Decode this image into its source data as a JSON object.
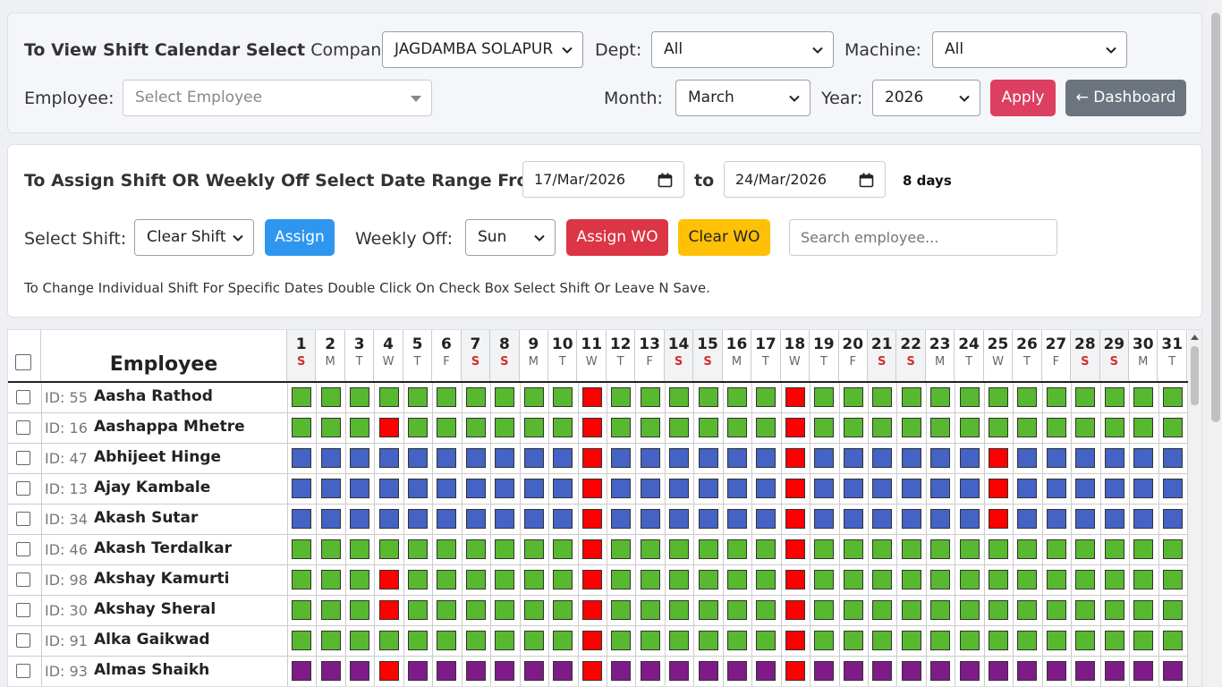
{
  "view": {
    "title": "To View Shift Calendar Select",
    "company_label": "Company:",
    "company_value": "JAGDAMBA SOLAPUR",
    "dept_label": "Dept:",
    "dept_value": "All",
    "machine_label": "Machine:",
    "machine_value": "All",
    "employee_label": "Employee:",
    "employee_placeholder": "Select Employee",
    "month_label": "Month:",
    "month_value": "March",
    "year_label": "Year:",
    "year_value": "2026",
    "apply_label": "Apply",
    "dashboard_label": "← Dashboard"
  },
  "assign": {
    "title": "To Assign Shift OR Weekly Off Select Date Range From:",
    "from_date": "17/Mar/2026",
    "to_label": "to",
    "to_date": "24/Mar/2026",
    "days_count": "8 days",
    "shift_label": "Select Shift:",
    "shift_value": "Clear Shift",
    "assign_label": "Assign",
    "weekly_off_label": "Weekly Off:",
    "weekly_off_value": "Sun",
    "assign_wo_label": "Assign WO",
    "clear_wo_label": "Clear WO",
    "search_placeholder": "Search employee...",
    "note": "To Change Individual Shift For Specific Dates Double Click On Check Box Select Shift Or Leave N Save."
  },
  "colors": {
    "apply": "#dc3f62",
    "dashboard": "#6c757d",
    "assign": "#2e96ef",
    "assign_wo": "#dc3545",
    "clear_wo": "#ffc107",
    "shift_G": "#58b82f",
    "shift_B": "#4463c5",
    "shift_R": "#ff0000",
    "shift_P": "#7f1b88"
  },
  "table": {
    "employee_header": "Employee",
    "days": [
      {
        "n": "1",
        "w": "S",
        "we": true
      },
      {
        "n": "2",
        "w": "M"
      },
      {
        "n": "3",
        "w": "T"
      },
      {
        "n": "4",
        "w": "W"
      },
      {
        "n": "5",
        "w": "T"
      },
      {
        "n": "6",
        "w": "F"
      },
      {
        "n": "7",
        "w": "S",
        "we": true
      },
      {
        "n": "8",
        "w": "S",
        "we": true
      },
      {
        "n": "9",
        "w": "M"
      },
      {
        "n": "10",
        "w": "T"
      },
      {
        "n": "11",
        "w": "W"
      },
      {
        "n": "12",
        "w": "T"
      },
      {
        "n": "13",
        "w": "F"
      },
      {
        "n": "14",
        "w": "S",
        "we": true
      },
      {
        "n": "15",
        "w": "S",
        "we": true
      },
      {
        "n": "16",
        "w": "M"
      },
      {
        "n": "17",
        "w": "T"
      },
      {
        "n": "18",
        "w": "W"
      },
      {
        "n": "19",
        "w": "T"
      },
      {
        "n": "20",
        "w": "F"
      },
      {
        "n": "21",
        "w": "S",
        "we": true
      },
      {
        "n": "22",
        "w": "S",
        "we": true
      },
      {
        "n": "23",
        "w": "M"
      },
      {
        "n": "24",
        "w": "T"
      },
      {
        "n": "25",
        "w": "W"
      },
      {
        "n": "26",
        "w": "T"
      },
      {
        "n": "27",
        "w": "F"
      },
      {
        "n": "28",
        "w": "S",
        "we": true
      },
      {
        "n": "29",
        "w": "S",
        "we": true
      },
      {
        "n": "30",
        "w": "M"
      },
      {
        "n": "31",
        "w": "T"
      }
    ],
    "rows": [
      {
        "id": "ID: 55",
        "name": "Aasha Rathod",
        "shifts": "GGGGGGGGGGRGGGGGGRGGGGGGGGGGGGG"
      },
      {
        "id": "ID: 16",
        "name": "Aashappa Mhetre",
        "shifts": "GGGRGGGGGGRGGGGGGRGGGGGGGGGGGGG"
      },
      {
        "id": "ID: 47",
        "name": "Abhijeet Hinge",
        "shifts": "BBBBBBBBBBRBBBBBBRBBBBBBRBBBBBB"
      },
      {
        "id": "ID: 13",
        "name": "Ajay Kambale",
        "shifts": "BBBBBBBBBBRBBBBBBRBBBBBBRBBBBBB"
      },
      {
        "id": "ID: 34",
        "name": "Akash Sutar",
        "shifts": "BBBBBBBBBBRBBBBBBRBBBBBBRBBBBBB"
      },
      {
        "id": "ID: 46",
        "name": "Akash Terdalkar",
        "shifts": "GGGGGGGGGGRGGGGGGRGGGGGGGGGGGGG"
      },
      {
        "id": "ID: 98",
        "name": "Akshay Kamurti",
        "shifts": "GGGRGGGGGGRGGGGGGRGGGGGGGGGGGGG"
      },
      {
        "id": "ID: 30",
        "name": "Akshay Sheral",
        "shifts": "GGGRGGGGGGRGGGGGGRGGGGGGGGGGGGG"
      },
      {
        "id": "ID: 91",
        "name": "Alka Gaikwad",
        "shifts": "GGGGGGGGGGRGGGGGGRGGGGGGGGGGGGG"
      },
      {
        "id": "ID: 93",
        "name": "Almas Shaikh",
        "shifts": "PPPRPPPPPPRPPPPPPRPPPPPPPPPPPPP"
      }
    ]
  }
}
